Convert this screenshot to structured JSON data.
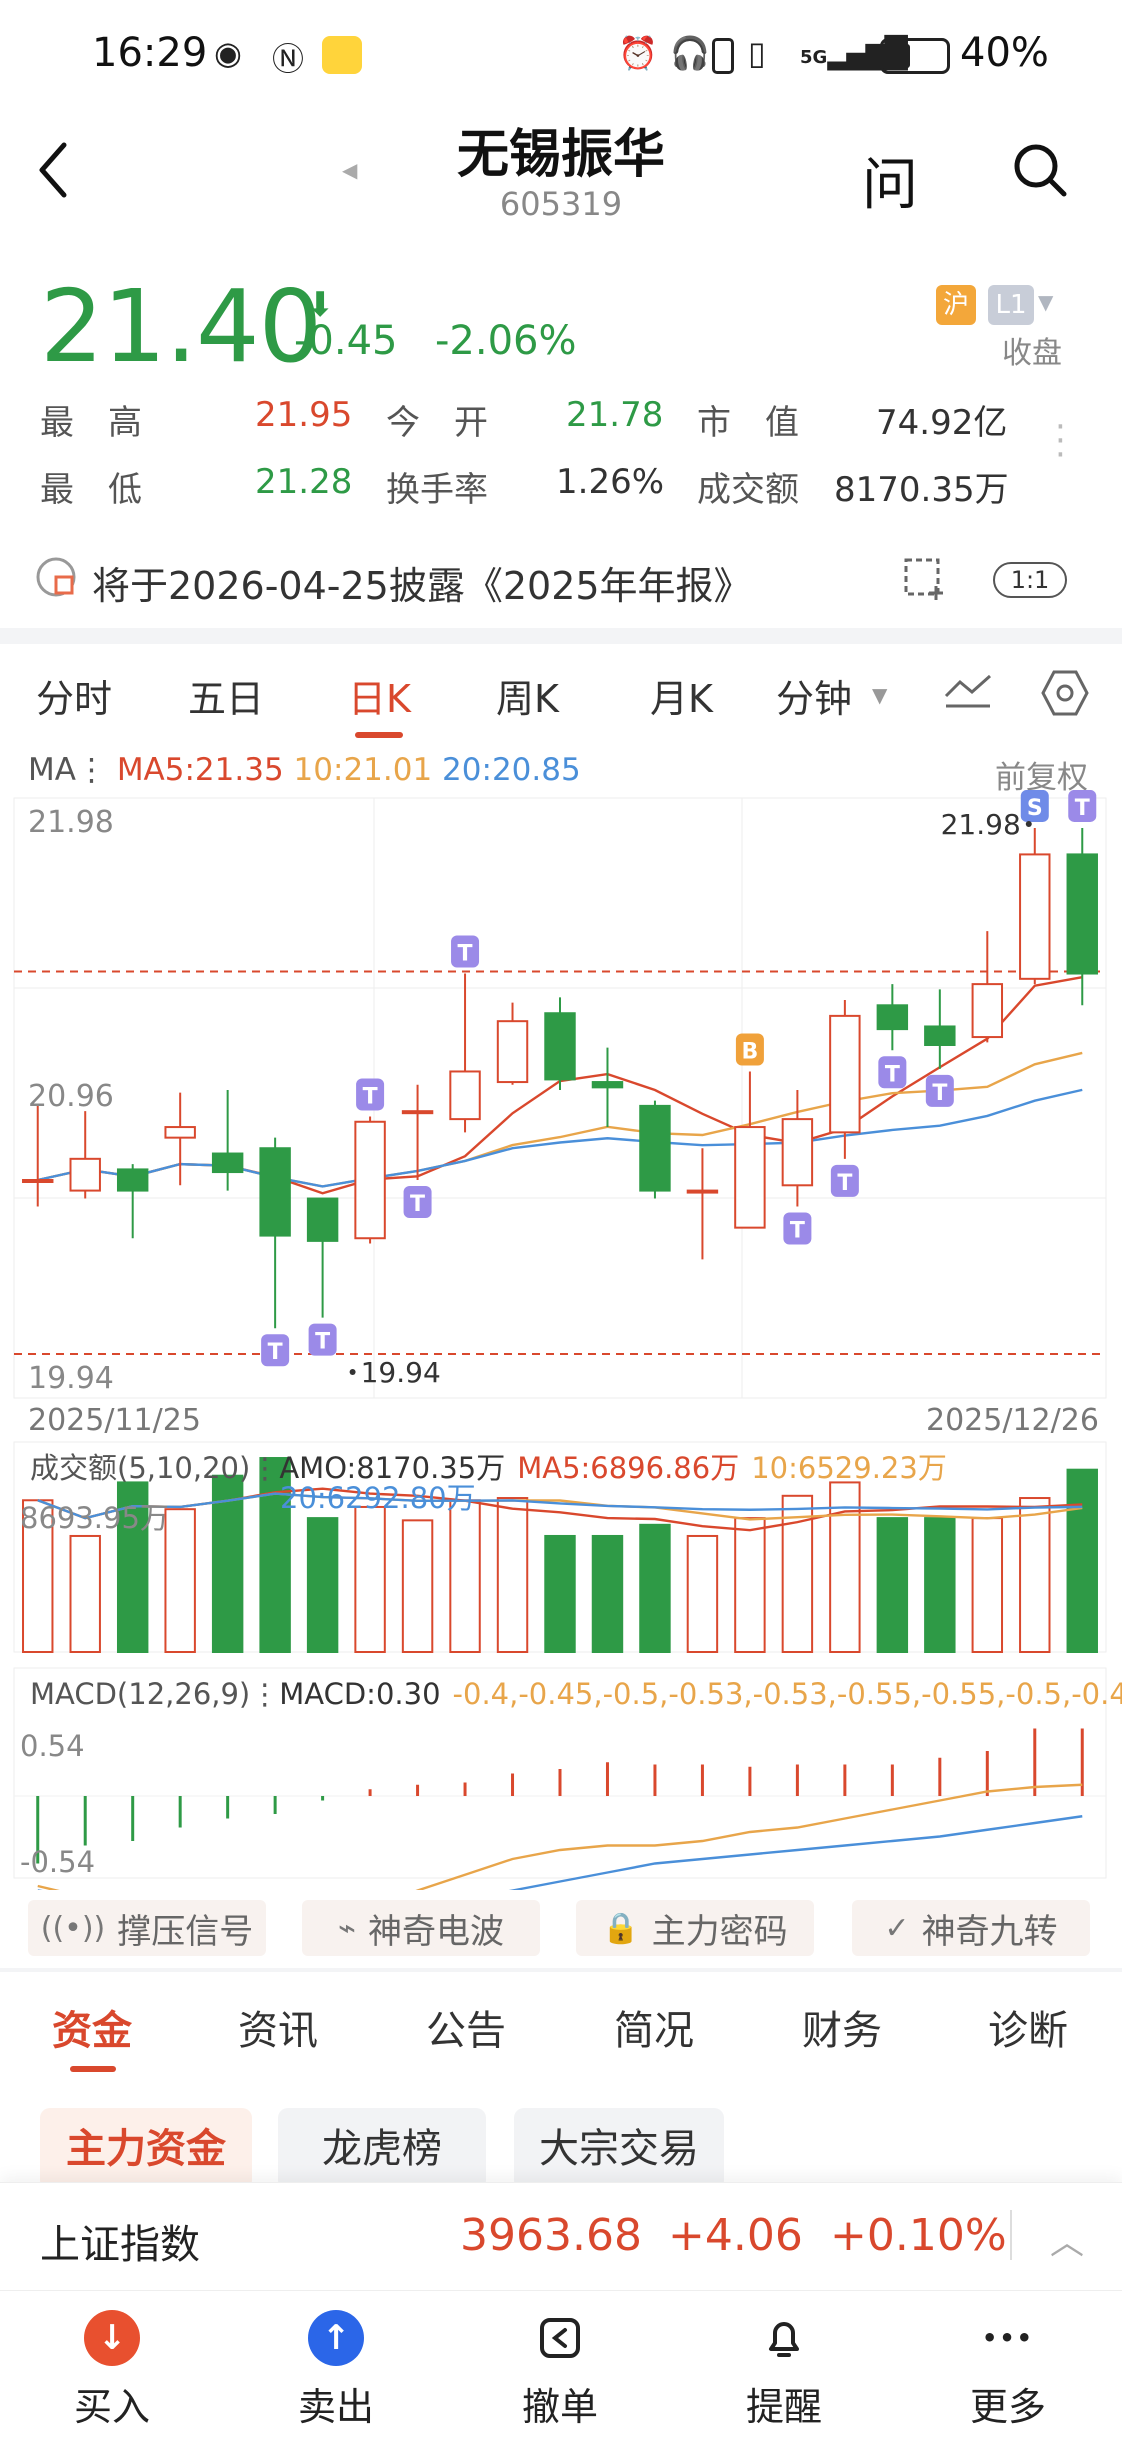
{
  "status_bar": {
    "time": "16:29",
    "icons": [
      "eye-icon",
      "nfc-icon",
      "app-icon",
      "alarm-icon",
      "headphone-icon",
      "battery-case-icon",
      "vibrate-icon",
      "5g-signal-icon",
      "battery-icon"
    ],
    "battery": "40%"
  },
  "header": {
    "name": "无锡振华",
    "code": "605319",
    "ask_label": "问"
  },
  "quote": {
    "price": "21.40",
    "change": "-0.45",
    "change_pct": "-2.06%",
    "market_badge": "沪",
    "level_badge": "L1",
    "status": "收盘",
    "colors": {
      "up": "#d9482d",
      "down": "#2e9a46"
    },
    "stats": [
      {
        "label": "最　高",
        "value": "21.95",
        "tone": "red"
      },
      {
        "label": "今　开",
        "value": "21.78",
        "tone": "green"
      },
      {
        "label": "市　值",
        "value": "74.92亿",
        "tone": "dark"
      },
      {
        "label": "最　低",
        "value": "21.28",
        "tone": "green"
      },
      {
        "label": "换手率",
        "value": "1.26%",
        "tone": "dark"
      },
      {
        "label": "成交额",
        "value": "8170.35万",
        "tone": "dark"
      }
    ]
  },
  "notice": {
    "text": "将于2026-04-25披露《2025年年报》",
    "layout_badge": "1:1"
  },
  "period_tabs": [
    "分时",
    "五日",
    "日K",
    "周K",
    "月K",
    "分钟"
  ],
  "ma_legend": {
    "prefix": "MA",
    "ma5": "MA5:21.35",
    "ma10": "10:21.01",
    "ma20": "20:20.85",
    "fuquan": "前复权"
  },
  "chart_data": {
    "type": "candlestick",
    "y_ticks": [
      "21.98",
      "20.96",
      "19.94"
    ],
    "ylim": [
      19.94,
      21.98
    ],
    "x_start": "2025/11/25",
    "x_end": "2025/12/26",
    "high_marker": "21.98",
    "low_marker": "19.94",
    "candles": [
      {
        "o": 20.62,
        "c": 20.62,
        "h": 20.9,
        "l": 20.52
      },
      {
        "o": 20.58,
        "c": 20.7,
        "h": 20.88,
        "l": 20.55
      },
      {
        "o": 20.66,
        "c": 20.58,
        "h": 20.68,
        "l": 20.4
      },
      {
        "o": 20.78,
        "c": 20.82,
        "h": 20.95,
        "l": 20.6
      },
      {
        "o": 20.72,
        "c": 20.65,
        "h": 20.96,
        "l": 20.58
      },
      {
        "o": 20.74,
        "c": 20.41,
        "h": 20.78,
        "l": 20.06
      },
      {
        "o": 20.55,
        "c": 20.39,
        "h": 20.55,
        "l": 20.1
      },
      {
        "o": 20.4,
        "c": 20.84,
        "h": 20.86,
        "l": 20.38
      },
      {
        "o": 20.88,
        "c": 20.88,
        "h": 20.98,
        "l": 20.62
      },
      {
        "o": 20.85,
        "c": 21.03,
        "h": 21.4,
        "l": 20.8
      },
      {
        "o": 20.99,
        "c": 21.22,
        "h": 21.29,
        "l": 20.98
      },
      {
        "o": 21.25,
        "c": 21.0,
        "h": 21.31,
        "l": 20.96
      },
      {
        "o": 20.99,
        "c": 20.97,
        "h": 21.12,
        "l": 20.82
      },
      {
        "o": 20.9,
        "c": 20.58,
        "h": 20.92,
        "l": 20.55
      },
      {
        "o": 20.58,
        "c": 20.58,
        "h": 20.74,
        "l": 20.32
      },
      {
        "o": 20.44,
        "c": 20.82,
        "h": 21.03,
        "l": 20.44
      },
      {
        "o": 20.6,
        "c": 20.85,
        "h": 20.96,
        "l": 20.52
      },
      {
        "o": 20.8,
        "c": 21.24,
        "h": 21.3,
        "l": 20.7
      },
      {
        "o": 21.28,
        "c": 21.19,
        "h": 21.36,
        "l": 21.11
      },
      {
        "o": 21.2,
        "c": 21.13,
        "h": 21.34,
        "l": 21.04
      },
      {
        "o": 21.16,
        "c": 21.36,
        "h": 21.56,
        "l": 21.14
      },
      {
        "o": 21.38,
        "c": 21.85,
        "h": 21.95,
        "l": 21.36
      },
      {
        "o": 21.85,
        "c": 21.4,
        "h": 21.95,
        "l": 21.28
      }
    ],
    "signals": [
      {
        "i": 5,
        "label": "T",
        "pos": "below"
      },
      {
        "i": 6,
        "label": "T",
        "pos": "below"
      },
      {
        "i": 7,
        "label": "T",
        "pos": "above"
      },
      {
        "i": 8,
        "label": "T",
        "pos": "below"
      },
      {
        "i": 9,
        "label": "T",
        "pos": "above"
      },
      {
        "i": 15,
        "label": "B",
        "pos": "above"
      },
      {
        "i": 16,
        "label": "T",
        "pos": "below"
      },
      {
        "i": 17,
        "label": "T",
        "pos": "below"
      },
      {
        "i": 18,
        "label": "T",
        "pos": "below"
      },
      {
        "i": 19,
        "label": "T",
        "pos": "below"
      },
      {
        "i": 21,
        "label": "S",
        "pos": "above"
      },
      {
        "i": 22,
        "label": "T",
        "pos": "above"
      }
    ],
    "volume": {
      "legend": "成交额(5,10,20)",
      "amo": "AMO:8170.35万",
      "ma5": "MA5:6896.86万",
      "ma10": "10:6529.23万",
      "ma20": "20:6292.80万",
      "max_label": "8693.95万",
      "values": [
        6800,
        5200,
        7600,
        6400,
        7900,
        8693,
        6000,
        6500,
        5900,
        6800,
        6900,
        5200,
        5200,
        5700,
        5200,
        6000,
        7000,
        7600,
        6000,
        6000,
        6000,
        6900,
        8170
      ]
    },
    "macd": {
      "legend": "MACD(12,26,9)",
      "macd": "MACD:0.30",
      "dif": [
        -0.4,
        -0.45,
        -0.5,
        -0.53,
        -0.53,
        -0.55,
        -0.55,
        -0.5,
        -0.42,
        -0.35,
        -0.28,
        -0.24,
        -0.22,
        -0.22,
        -0.2,
        -0.16,
        -0.14,
        -0.1,
        -0.06,
        -0.02,
        0.02,
        0.04,
        0.05
      ],
      "dea": [
        -0.42,
        -0.45,
        -0.48,
        -0.5,
        -0.52,
        -0.52,
        -0.53,
        -0.52,
        -0.5,
        -0.46,
        -0.42,
        -0.38,
        -0.34,
        -0.3,
        -0.28,
        -0.26,
        -0.24,
        -0.22,
        -0.2,
        -0.18,
        -0.15,
        -0.12,
        -0.09
      ],
      "ylabel_top": "0.54",
      "ylabel_bottom": "-0.54",
      "hist": [
        -0.3,
        -0.22,
        -0.2,
        -0.14,
        -0.1,
        -0.08,
        -0.02,
        0.03,
        0.05,
        0.06,
        0.1,
        0.12,
        0.15,
        0.14,
        0.14,
        0.13,
        0.14,
        0.14,
        0.14,
        0.17,
        0.2,
        0.3,
        0.3
      ]
    }
  },
  "signal_buttons": [
    {
      "icon": "radar-icon",
      "label": "撑压信号"
    },
    {
      "icon": "wave-icon",
      "label": "神奇电波"
    },
    {
      "icon": "lock-icon",
      "label": "主力密码"
    },
    {
      "icon": "check-circle-icon",
      "label": "神奇九转"
    }
  ],
  "content_tabs": [
    "资金",
    "资讯",
    "公告",
    "简况",
    "财务",
    "诊断"
  ],
  "sub_tabs": [
    "主力资金",
    "龙虎榜",
    "大宗交易"
  ],
  "index_bar": {
    "name": "上证指数",
    "value": "3963.68",
    "change": "+4.06",
    "pct": "+0.10%"
  },
  "bottom_nav": [
    {
      "label": "买入",
      "icon": "buy-icon",
      "glyph": "↓",
      "color": "#e8502f"
    },
    {
      "label": "卖出",
      "icon": "sell-icon",
      "glyph": "↑",
      "color": "#2b66e8"
    },
    {
      "label": "撤单",
      "icon": "cancel-order-icon",
      "glyph": "",
      "color": ""
    },
    {
      "label": "提醒",
      "icon": "bell-icon",
      "glyph": "",
      "color": ""
    },
    {
      "label": "更多",
      "icon": "more-icon",
      "glyph": "•••",
      "color": ""
    }
  ]
}
